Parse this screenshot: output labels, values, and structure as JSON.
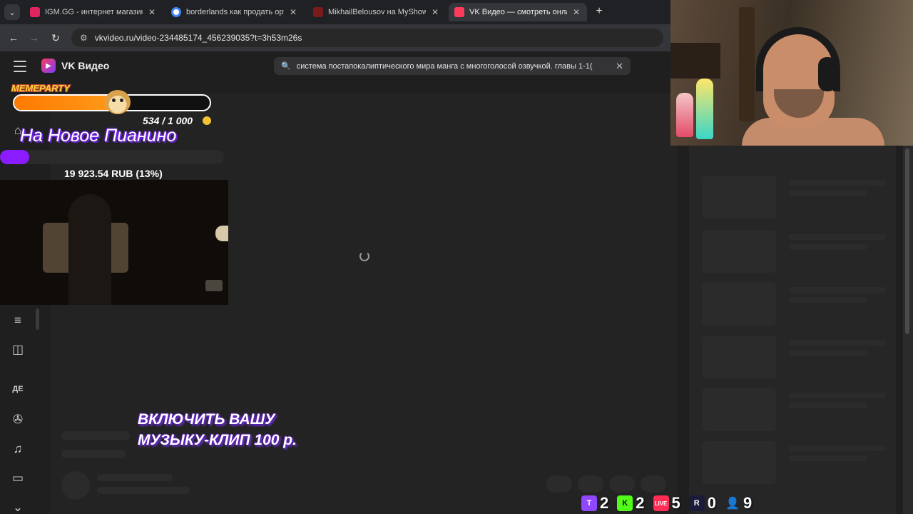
{
  "tabs": [
    {
      "label": "IGM.GG - интернет магазин кл",
      "favicon_color": "#e0245e"
    },
    {
      "label": "borderlands как продать оруж",
      "favicon_color": "#4285f4"
    },
    {
      "label": "MikhailBelousov на MyShows.r",
      "favicon_color": "#7a1b1b"
    },
    {
      "label": "VK Видео — смотреть онлайн",
      "favicon_color": "#ff3b5c"
    }
  ],
  "address": {
    "url": "vkvideo.ru/video-234485174_456239035?t=3h53m26s"
  },
  "vk": {
    "brand": "VK Видео",
    "search_value": "система постапокалиптического мира манга с многоголосой озвучкой. главы 1-1("
  },
  "overlay": {
    "meme_title": "MEMEPARTY",
    "meme_count": "534 / 1 000",
    "meme_progress": 0.534,
    "goal_title": "На Новое Пианино",
    "goal_amount": "19 923.54 RUB (13%)",
    "goal_progress": 0.13,
    "promo_line1": "ВКЛЮЧИТЬ ВАШУ",
    "promo_line2": "МУЗЫКУ-КЛИП 100 р."
  },
  "stats": [
    {
      "icon": "twitch-icon",
      "value": "2",
      "color": "#9146ff",
      "glyph": "T"
    },
    {
      "icon": "kick-icon",
      "value": "2",
      "color": "#53fc18",
      "glyph": "K"
    },
    {
      "icon": "vk-live-icon",
      "value": "5",
      "color": "#ff2d55",
      "glyph": "LIVE"
    },
    {
      "icon": "rutube-icon",
      "value": "0",
      "color": "#1b1b3a",
      "glyph": "R"
    },
    {
      "icon": "viewers-icon",
      "value": "9",
      "color": "#4aa3ff",
      "glyph": "👤"
    }
  ]
}
